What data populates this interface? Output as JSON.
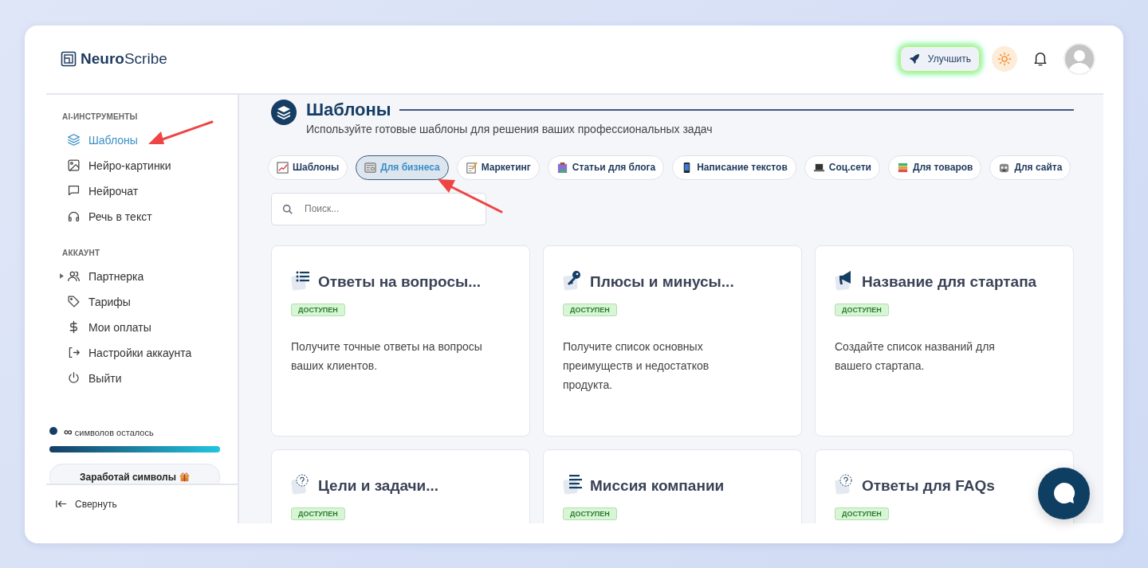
{
  "logo": {
    "bold": "Neuro",
    "light": "Scribe"
  },
  "header": {
    "upgrade_label": "Улучшить"
  },
  "sidebar": {
    "sections": [
      {
        "title": "AI-ИНСТРУМЕНТЫ",
        "items": [
          {
            "label": "Шаблоны",
            "selected": true
          },
          {
            "label": "Нейро-картинки",
            "selected": false
          },
          {
            "label": "Нейрочат",
            "selected": false
          },
          {
            "label": "Речь в текст",
            "selected": false
          }
        ]
      },
      {
        "title": "АККАУНТ",
        "items": [
          {
            "label": "Партнерка",
            "selected": false,
            "expanded": false
          },
          {
            "label": "Тарифы",
            "selected": false
          },
          {
            "label": "Мои оплаты",
            "selected": false
          },
          {
            "label": "Настройки аккаунта",
            "selected": false
          },
          {
            "label": "Выйти",
            "selected": false
          }
        ]
      }
    ],
    "credits": {
      "amount": "∞",
      "text": "символов осталось",
      "level": 1
    },
    "earn_button": "Заработай символы",
    "collapse": "Свернуть"
  },
  "page": {
    "title": "Шаблоны",
    "subtitle": "Используйте готовые шаблоны для решения ваших профессиональных задач"
  },
  "categories": [
    {
      "label": "Шаблоны",
      "selected": false
    },
    {
      "label": "Для бизнеса",
      "selected": true
    },
    {
      "label": "Маркетинг",
      "selected": false
    },
    {
      "label": "Статьи для блога",
      "selected": false
    },
    {
      "label": "Написание текстов",
      "selected": false
    },
    {
      "label": "Соц.сети",
      "selected": false
    },
    {
      "label": "Для товаров",
      "selected": false
    },
    {
      "label": "Для сайта",
      "selected": false
    }
  ],
  "search": {
    "placeholder": "Поиск..."
  },
  "templates": [
    {
      "title": "Ответы на вопросы...",
      "badge": "ДОСТУПЕН",
      "description": "Получите точные ответы на вопросы ваших клиентов."
    },
    {
      "title": "Плюсы и минусы...",
      "badge": "ДОСТУПЕН",
      "description": "Получите список основных преимуществ и недостатков продукта."
    },
    {
      "title": "Название для стартапа",
      "badge": "ДОСТУПЕН",
      "description": "Создайте список названий для вашего стартапа."
    },
    {
      "title": "Цели и задачи...",
      "badge": "ДОСТУПЕН"
    },
    {
      "title": "Миссия компании",
      "badge": "ДОСТУПЕН"
    },
    {
      "title": "Ответы для FAQs",
      "badge": "ДОСТУПЕН"
    }
  ]
}
